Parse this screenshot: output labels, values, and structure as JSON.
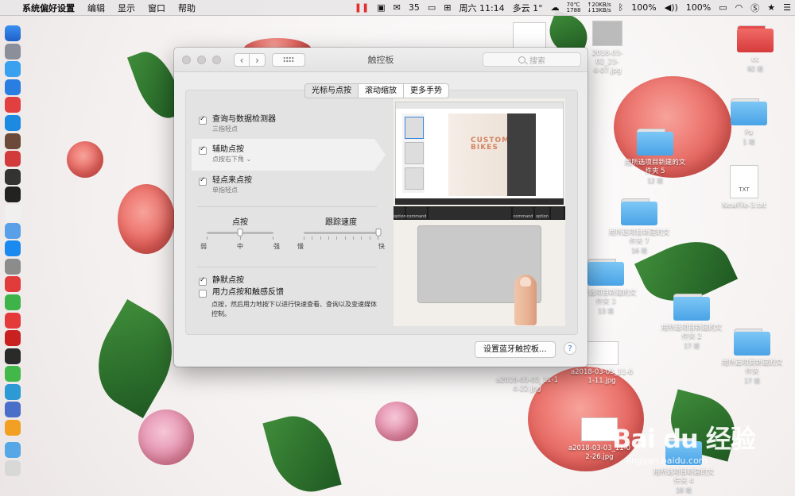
{
  "menubar": {
    "app_name": "系统偏好设置",
    "menus": [
      "编辑",
      "显示",
      "窗口",
      "帮助"
    ],
    "wechat_count": "35",
    "cpu_temp": "70℃",
    "fan_rpm": "1788",
    "net_up": "↑20KB/s",
    "net_down": "↓13KB/s",
    "datetime": "周六 11:14",
    "weather": "多云 1°",
    "volume": "100%",
    "battery": "100%"
  },
  "window": {
    "title": "触控板",
    "search_placeholder": "搜索",
    "tabs": [
      "光标与点按",
      "滚动缩放",
      "更多手势"
    ],
    "options": [
      {
        "label": "查询与数据检测器",
        "sub": "三指轻点",
        "checked": true
      },
      {
        "label": "辅助点按",
        "sub": "点按右下角 ⌄",
        "checked": true
      },
      {
        "label": "轻点来点按",
        "sub": "单指轻点",
        "checked": true
      }
    ],
    "click_slider": {
      "title": "点按",
      "labels": [
        "弱",
        "中",
        "强"
      ],
      "value": 0.5
    },
    "speed_slider": {
      "title": "跟踪速度",
      "labels": [
        "慢",
        "快"
      ],
      "value": 1.0
    },
    "silent_click": {
      "label": "静默点按",
      "checked": true
    },
    "force_click": {
      "label": "用力点按和触感反馈",
      "checked": false
    },
    "force_desc": "点按，然后用力地按下以进行快速查看、查询以及变速媒体控制。",
    "preview": {
      "doc_title_1": "CUSTOM",
      "doc_title_2": "BIKES",
      "key_labels": [
        "option",
        "command",
        "command",
        "option"
      ]
    },
    "bluetooth_button": "设置蓝牙触控板...",
    "help": "?"
  },
  "desktop": {
    "items": [
      {
        "name": "cc",
        "sub": "92 项"
      },
      {
        "name": "2018-03-02_23-",
        "name2": "4-07.jpg"
      },
      {
        "name": "Pa",
        "sub": "1 项"
      },
      {
        "name": "用所选项目新建的文",
        "name2": "件夹 5",
        "sub": "12 项"
      },
      {
        "name": "NewFile-3.txt",
        "badge": "TXT"
      },
      {
        "name": "用所选项目新建的文",
        "name2": "件夹 7",
        "sub": "16 项"
      },
      {
        "name": "用所选项目新建的文",
        "name2": "件夹 3",
        "sub": "13 项"
      },
      {
        "name": "用所选项目新建的文",
        "name2": "件夹 2",
        "sub": "17 项"
      },
      {
        "name": "用所选项目新建的文",
        "name2": "件夹",
        "sub": "17 项"
      },
      {
        "name": "a2018-03-03_11-1",
        "name2": "4-22.jpg"
      },
      {
        "name": "a2018-03-03_11-0",
        "name2": "1-11.jpg"
      },
      {
        "name": "a2018-03-03_11-0",
        "name2": "2-26.jpg"
      },
      {
        "name": "用所选项目新建的文",
        "name2": "件夹 4",
        "sub": "18 项"
      }
    ]
  },
  "watermark": {
    "logo": "Bai du 经验",
    "url": "jingyan.baidu.com"
  },
  "colors": {
    "accent": "#3b78d8",
    "folder": "#5fb4f0",
    "red_folder": "#e04848"
  }
}
